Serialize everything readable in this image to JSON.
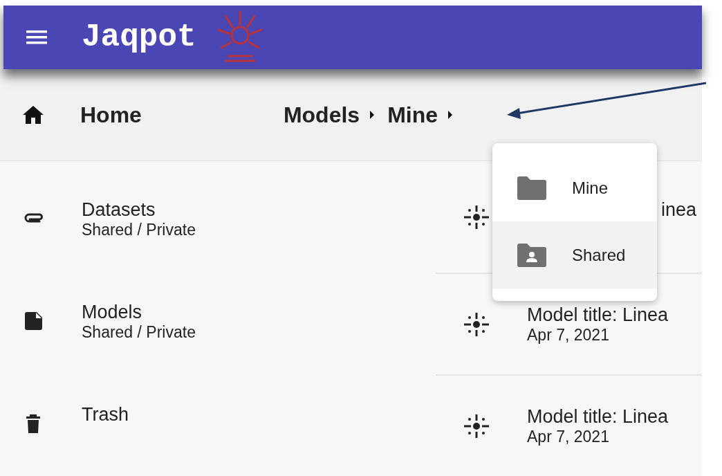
{
  "app_bar": {
    "title": "Jaqpot"
  },
  "breadcrumb": {
    "home": "Home",
    "path": [
      "Models",
      "Mine"
    ]
  },
  "sidebar": {
    "items": [
      {
        "kind": "datasets",
        "label": "Datasets",
        "sub": "Shared / Private"
      },
      {
        "kind": "models",
        "label": "Models",
        "sub": "Shared / Private"
      },
      {
        "kind": "trash",
        "label": "Trash"
      }
    ]
  },
  "models": [
    {
      "kind": "covered",
      "title": "inea"
    },
    {
      "kind": "model",
      "title": "Model title: Linea",
      "date": "Apr 7, 2021"
    },
    {
      "kind": "model",
      "title": "Model title: Linea",
      "date": "Apr 7, 2021"
    }
  ],
  "menu": {
    "items": [
      {
        "kind": "folder",
        "label": "Mine",
        "selected": false
      },
      {
        "kind": "shared",
        "label": "Shared",
        "selected": true
      }
    ]
  }
}
